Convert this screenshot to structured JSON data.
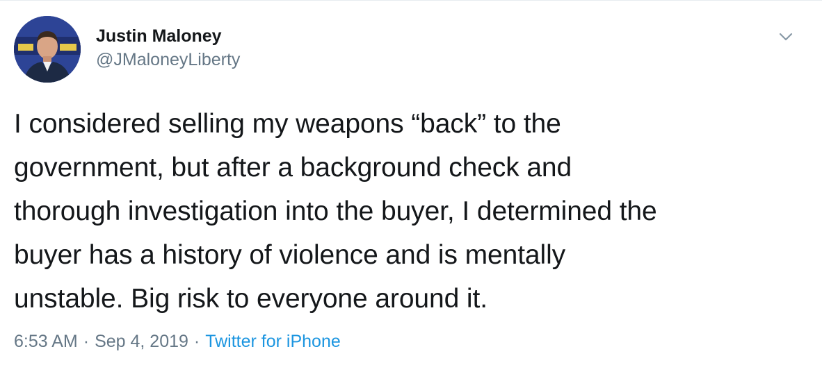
{
  "tweet": {
    "author": {
      "display_name": "Justin Maloney",
      "handle": "@JMaloneyLiberty",
      "avatar_icon": "profile-photo"
    },
    "text_lines": [
      "I considered selling my weapons “back” to the",
      "government, but after a background check and",
      "thorough investigation into the buyer, I determined the",
      "buyer has a history of violence and is mentally",
      "unstable. Big risk to everyone around it."
    ],
    "time": "6:53 AM",
    "separator": "·",
    "date": "Sep 4, 2019",
    "source": "Twitter for iPhone",
    "menu_icon": "chevron-down-icon"
  },
  "colors": {
    "text": "#14171a",
    "secondary": "#657786",
    "link": "#1b95e0"
  }
}
